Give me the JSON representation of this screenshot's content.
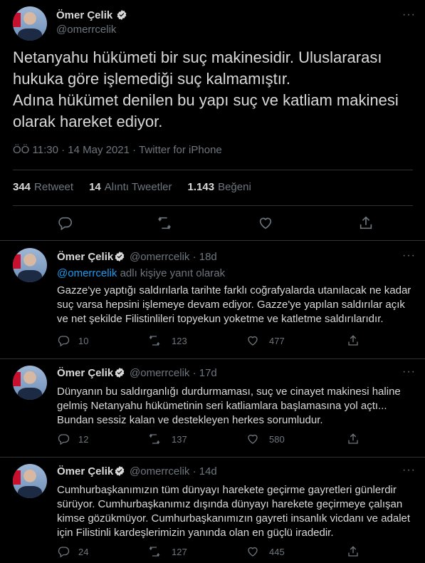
{
  "main_tweet": {
    "author_name": "Ömer Çelik",
    "author_handle": "@omerrcelik",
    "text": "Netanyahu hükümeti bir suç makinesidir. Uluslararası hukuka göre işlemediği suç kalmamıştır.\nAdına hükümet denilen bu yapı suç ve katliam makinesi olarak hareket ediyor.",
    "meta": "ÖÖ 11:30 · 14 May 2021 · Twitter for iPhone",
    "stats": {
      "retweets_count": "344",
      "retweets_label": "Retweet",
      "quotes_count": "14",
      "quotes_label": "Alıntı Tweetler",
      "likes_count": "1.143",
      "likes_label": "Beğeni"
    }
  },
  "replies": [
    {
      "author_name": "Ömer Çelik",
      "author_handle": "@omerrcelik",
      "time": "18d",
      "replying_to_handle": "@omerrcelik",
      "replying_to_suffix": "adlı kişiye yanıt olarak",
      "text": "Gazze'ye yaptığı saldırılarla tarihte farklı coğrafyalarda utanılacak ne kadar suç varsa hepsini işlemeye devam ediyor. Gazze'ye yapılan saldırılar açık ve net şekilde Filistinlileri topyekun yoketme ve katletme saldırılarıdır.",
      "replies": "10",
      "retweets": "123",
      "likes": "477"
    },
    {
      "author_name": "Ömer Çelik",
      "author_handle": "@omerrcelik",
      "time": "17d",
      "text": "Dünyanın bu saldırganlığı durdurmaması, suç ve cinayet makinesi haline gelmiş Netanyahu hükümetinin seri katliamlara başlamasına yol açtı... Bundan sessiz kalan ve destekleyen herkes sorumludur.",
      "replies": "12",
      "retweets": "137",
      "likes": "580"
    },
    {
      "author_name": "Ömer Çelik",
      "author_handle": "@omerrcelik",
      "time": "14d",
      "text": "Cumhurbaşkanımızın tüm dünyayı harekete geçirme gayretleri günlerdir sürüyor. Cumhurbaşkanımız dışında dünyayı harekete geçirmeye çalışan kimse gözükmüyor. Cumhurbaşkanımızın gayreti insanlık vicdanı ve adalet için Filistinli kardeşlerimizin yanında olan en güçlü iradedir.",
      "replies": "24",
      "retweets": "127",
      "likes": "445"
    }
  ],
  "separator": "·",
  "more_glyph": "···",
  "icons": [
    "verified-icon",
    "reply-icon",
    "retweet-icon",
    "like-icon",
    "share-icon",
    "more-icon"
  ],
  "colors": {
    "background": "#000000",
    "text": "#d9d9d9",
    "muted": "#6e767d",
    "link": "#1d9bf0",
    "verified": "#d9d9d9"
  }
}
